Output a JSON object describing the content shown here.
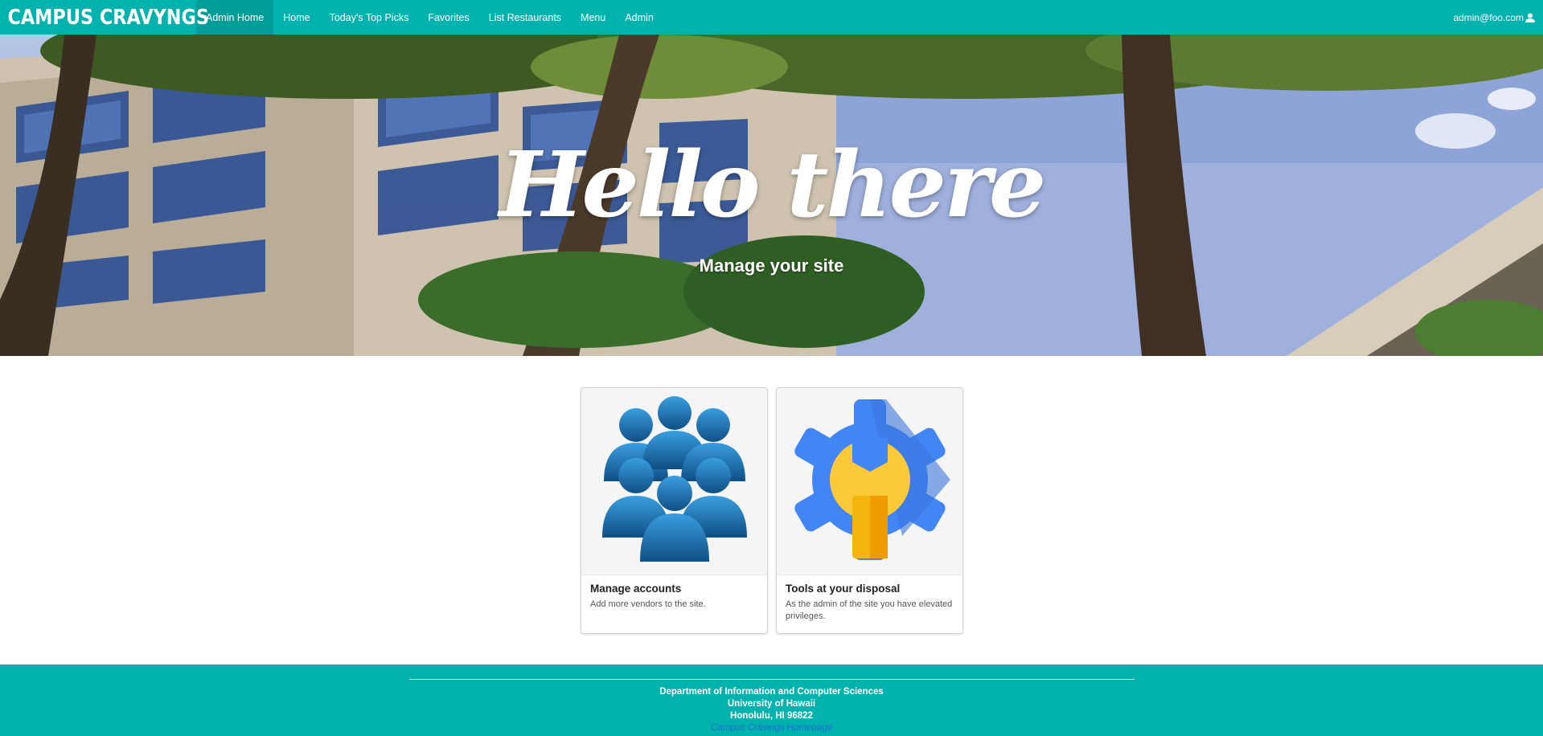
{
  "nav": {
    "brand": "CAMPUS CRAVYNGS",
    "items": [
      {
        "label": "Admin Home",
        "active": true
      },
      {
        "label": "Home",
        "active": false
      },
      {
        "label": "Today's Top Picks",
        "active": false
      },
      {
        "label": "Favorites",
        "active": false
      },
      {
        "label": "List Restaurants",
        "active": false
      },
      {
        "label": "Menu",
        "active": false
      },
      {
        "label": "Admin",
        "active": false
      }
    ],
    "user_email": "admin@foo.com",
    "user_icon": "user-icon"
  },
  "hero": {
    "title": "Hello there",
    "subtitle": "Manage your site"
  },
  "cards": [
    {
      "header": "Manage accounts",
      "description": "Add more vendors to the site.",
      "icon": "people-group-icon"
    },
    {
      "header": "Tools at your disposal",
      "description": "As the admin of the site you have elevated privileges.",
      "icon": "settings-wrench-icon"
    }
  ],
  "footer": {
    "line1": "Department of Information and Computer Sciences",
    "line2": "University of Hawaii",
    "line3": "Honolulu, HI 96822",
    "link": "Campus Cravings Homepage"
  },
  "colors": {
    "primary": "#00b2ae",
    "active_nav": "#009c98",
    "people_blue": "#1b6aa3",
    "gear_blue": "#3f7ee8",
    "wrench_yellow": "#f9c433"
  }
}
